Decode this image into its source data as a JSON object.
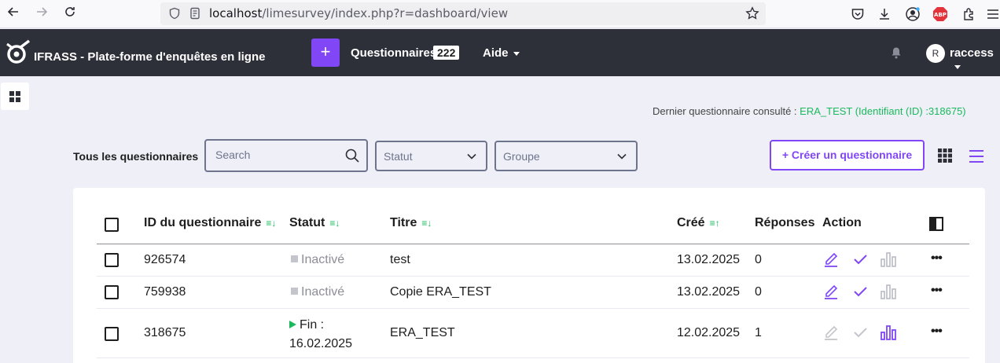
{
  "browser": {
    "url_host": "localhost",
    "url_path": "/limesurvey/index.php?r=dashboard/view"
  },
  "header": {
    "brand": "IFRASS - Plate-forme d'enquêtes en ligne",
    "create_plus": "+",
    "surveys_menu": "Questionnaires",
    "surveys_count": "222",
    "help_menu": "Aide",
    "user_initial": "R",
    "user_name": "raccess"
  },
  "last_consulted": {
    "label": "Dernier questionnaire consulté : ",
    "link": "ERA_TEST (Identifiant (ID) :318675)"
  },
  "toolbar": {
    "title": "Tous les questionnaires",
    "search_placeholder": "Search",
    "status_placeholder": "Statut",
    "group_placeholder": "Groupe",
    "create_button": "+ Créer un questionnaire"
  },
  "table": {
    "headers": {
      "id": "ID du questionnaire",
      "status": "Statut",
      "title": "Titre",
      "created": "Créé",
      "responses": "Réponses",
      "action": "Action"
    },
    "rows": [
      {
        "id": "926574",
        "status": "Inactivé",
        "status_type": "inactive",
        "title": "test",
        "created": "13.02.2025",
        "responses": "0",
        "editable": true
      },
      {
        "id": "759938",
        "status": "Inactivé",
        "status_type": "inactive",
        "title": "Copie ERA_TEST",
        "created": "13.02.2025",
        "responses": "0",
        "editable": true
      },
      {
        "id": "318675",
        "status": "Fin :",
        "status_date": "16.02.2025",
        "status_type": "active",
        "title": "ERA_TEST",
        "created": "12.02.2025",
        "responses": "1",
        "editable": false
      }
    ],
    "more_label": "•••"
  },
  "colors": {
    "accent": "#8146f6",
    "success": "#1aba5c",
    "header_bg": "#2d2f39",
    "page_bg": "#eeeff7"
  }
}
